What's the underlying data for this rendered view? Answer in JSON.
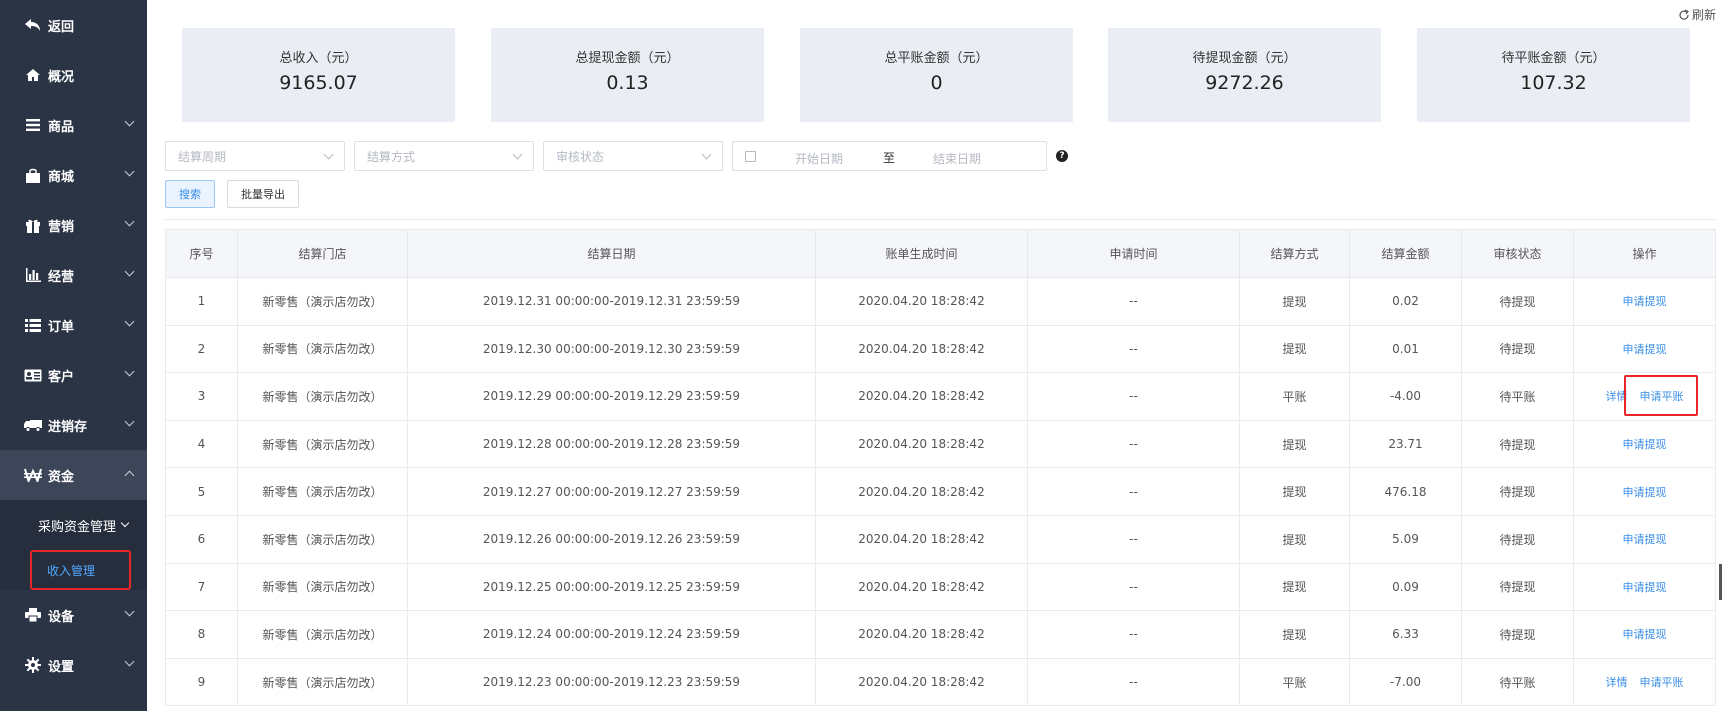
{
  "sidebar": {
    "items": [
      {
        "label": "返回",
        "icon": "back-arrow-icon"
      },
      {
        "label": "概况",
        "icon": "home-icon"
      },
      {
        "label": "商品",
        "icon": "menu-bars-icon"
      },
      {
        "label": "商城",
        "icon": "shopping-bag-icon"
      },
      {
        "label": "营销",
        "icon": "gift-icon"
      },
      {
        "label": "经营",
        "icon": "bar-chart-icon"
      },
      {
        "label": "订单",
        "icon": "list-icon"
      },
      {
        "label": "客户",
        "icon": "id-card-icon"
      },
      {
        "label": "进销存",
        "icon": "truck-icon"
      },
      {
        "label": "资金",
        "icon": "won-sign-icon"
      },
      {
        "label": "设备",
        "icon": "printer-icon"
      },
      {
        "label": "设置",
        "icon": "gear-icon"
      }
    ],
    "sub_group_title": "采购资金管理",
    "sub_item": "收入管理"
  },
  "header": {
    "refresh_label": "刷新"
  },
  "stats": [
    {
      "label": "总收入（元）",
      "value": "9165.07"
    },
    {
      "label": "总提现金额（元）",
      "value": "0.13"
    },
    {
      "label": "总平账金额（元）",
      "value": "0"
    },
    {
      "label": "待提现金额（元）",
      "value": "9272.26"
    },
    {
      "label": "待平账金额（元）",
      "value": "107.32"
    }
  ],
  "filters": {
    "period_placeholder": "结算周期",
    "method_placeholder": "结算方式",
    "status_placeholder": "审核状态",
    "start_date_placeholder": "开始日期",
    "to_label": "至",
    "end_date_placeholder": "结束日期",
    "help": "?"
  },
  "buttons": {
    "search": "搜索",
    "export": "批量导出"
  },
  "table": {
    "columns": [
      "序号",
      "结算门店",
      "结算日期",
      "账单生成时间",
      "申请时间",
      "结算方式",
      "结算金额",
      "审核状态",
      "操作"
    ],
    "rows": [
      {
        "no": "1",
        "store": "新零售（演示店勿改）",
        "period": "2019.12.31 00:00:00-2019.12.31 23:59:59",
        "created": "2020.04.20 18:28:42",
        "applied": "--",
        "method": "提现",
        "amount": "0.02",
        "status": "待提现",
        "detail": "",
        "action": "申请提现"
      },
      {
        "no": "2",
        "store": "新零售（演示店勿改）",
        "period": "2019.12.30 00:00:00-2019.12.30 23:59:59",
        "created": "2020.04.20 18:28:42",
        "applied": "--",
        "method": "提现",
        "amount": "0.01",
        "status": "待提现",
        "detail": "",
        "action": "申请提现"
      },
      {
        "no": "3",
        "store": "新零售（演示店勿改）",
        "period": "2019.12.29 00:00:00-2019.12.29 23:59:59",
        "created": "2020.04.20 18:28:42",
        "applied": "--",
        "method": "平账",
        "amount": "-4.00",
        "status": "待平账",
        "detail": "详情",
        "action": "申请平账"
      },
      {
        "no": "4",
        "store": "新零售（演示店勿改）",
        "period": "2019.12.28 00:00:00-2019.12.28 23:59:59",
        "created": "2020.04.20 18:28:42",
        "applied": "--",
        "method": "提现",
        "amount": "23.71",
        "status": "待提现",
        "detail": "",
        "action": "申请提现"
      },
      {
        "no": "5",
        "store": "新零售（演示店勿改）",
        "period": "2019.12.27 00:00:00-2019.12.27 23:59:59",
        "created": "2020.04.20 18:28:42",
        "applied": "--",
        "method": "提现",
        "amount": "476.18",
        "status": "待提现",
        "detail": "",
        "action": "申请提现"
      },
      {
        "no": "6",
        "store": "新零售（演示店勿改）",
        "period": "2019.12.26 00:00:00-2019.12.26 23:59:59",
        "created": "2020.04.20 18:28:42",
        "applied": "--",
        "method": "提现",
        "amount": "5.09",
        "status": "待提现",
        "detail": "",
        "action": "申请提现"
      },
      {
        "no": "7",
        "store": "新零售（演示店勿改）",
        "period": "2019.12.25 00:00:00-2019.12.25 23:59:59",
        "created": "2020.04.20 18:28:42",
        "applied": "--",
        "method": "提现",
        "amount": "0.09",
        "status": "待提现",
        "detail": "",
        "action": "申请提现"
      },
      {
        "no": "8",
        "store": "新零售（演示店勿改）",
        "period": "2019.12.24 00:00:00-2019.12.24 23:59:59",
        "created": "2020.04.20 18:28:42",
        "applied": "--",
        "method": "提现",
        "amount": "6.33",
        "status": "待提现",
        "detail": "",
        "action": "申请提现"
      },
      {
        "no": "9",
        "store": "新零售（演示店勿改）",
        "period": "2019.12.23 00:00:00-2019.12.23 23:59:59",
        "created": "2020.04.20 18:28:42",
        "applied": "--",
        "method": "平账",
        "amount": "-7.00",
        "status": "待平账",
        "detail": "详情",
        "action": "申请平账"
      }
    ]
  }
}
